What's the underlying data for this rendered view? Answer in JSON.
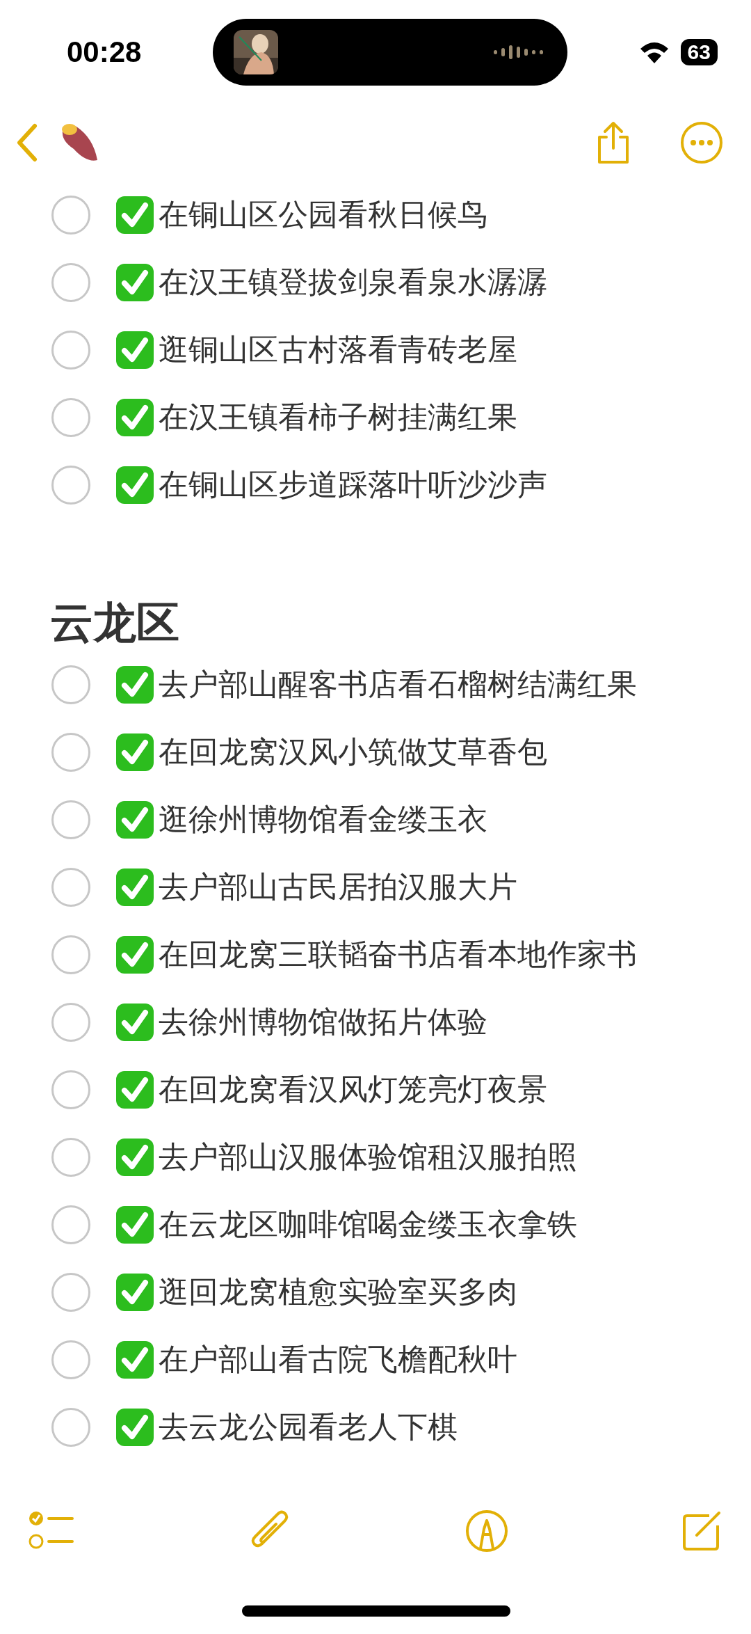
{
  "status_bar": {
    "time": "00:28",
    "battery": "63"
  },
  "sections": [
    {
      "items": [
        {
          "text": "在铜山区公园看秋日候鸟",
          "checked": false
        },
        {
          "text": "在汉王镇登拔剑泉看泉水潺潺",
          "checked": false
        },
        {
          "text": "逛铜山区古村落看青砖老屋",
          "checked": false
        },
        {
          "text": "在汉王镇看柿子树挂满红果",
          "checked": false
        },
        {
          "text": "在铜山区步道踩落叶听沙沙声",
          "checked": false
        }
      ]
    },
    {
      "heading": "云龙区",
      "items": [
        {
          "text": "去户部山醒客书店看石榴树结满红果",
          "checked": false
        },
        {
          "text": "在回龙窝汉风小筑做艾草香包",
          "checked": false
        },
        {
          "text": "逛徐州博物馆看金缕玉衣",
          "checked": false
        },
        {
          "text": "去户部山古民居拍汉服大片",
          "checked": false
        },
        {
          "text": "在回龙窝三联韬奋书店看本地作家书",
          "checked": false
        },
        {
          "text": "去徐州博物馆做拓片体验",
          "checked": false
        },
        {
          "text": "在回龙窝看汉风灯笼亮灯夜景",
          "checked": false
        },
        {
          "text": "去户部山汉服体验馆租汉服拍照",
          "checked": false
        },
        {
          "text": "在云龙区咖啡馆喝金缕玉衣拿铁",
          "checked": false
        },
        {
          "text": "逛回龙窝植愈实验室买多肉",
          "checked": false
        },
        {
          "text": "在户部山看古院飞檐配秋叶",
          "checked": false
        },
        {
          "text": "去云龙公园看老人下棋",
          "checked": false
        }
      ]
    }
  ]
}
